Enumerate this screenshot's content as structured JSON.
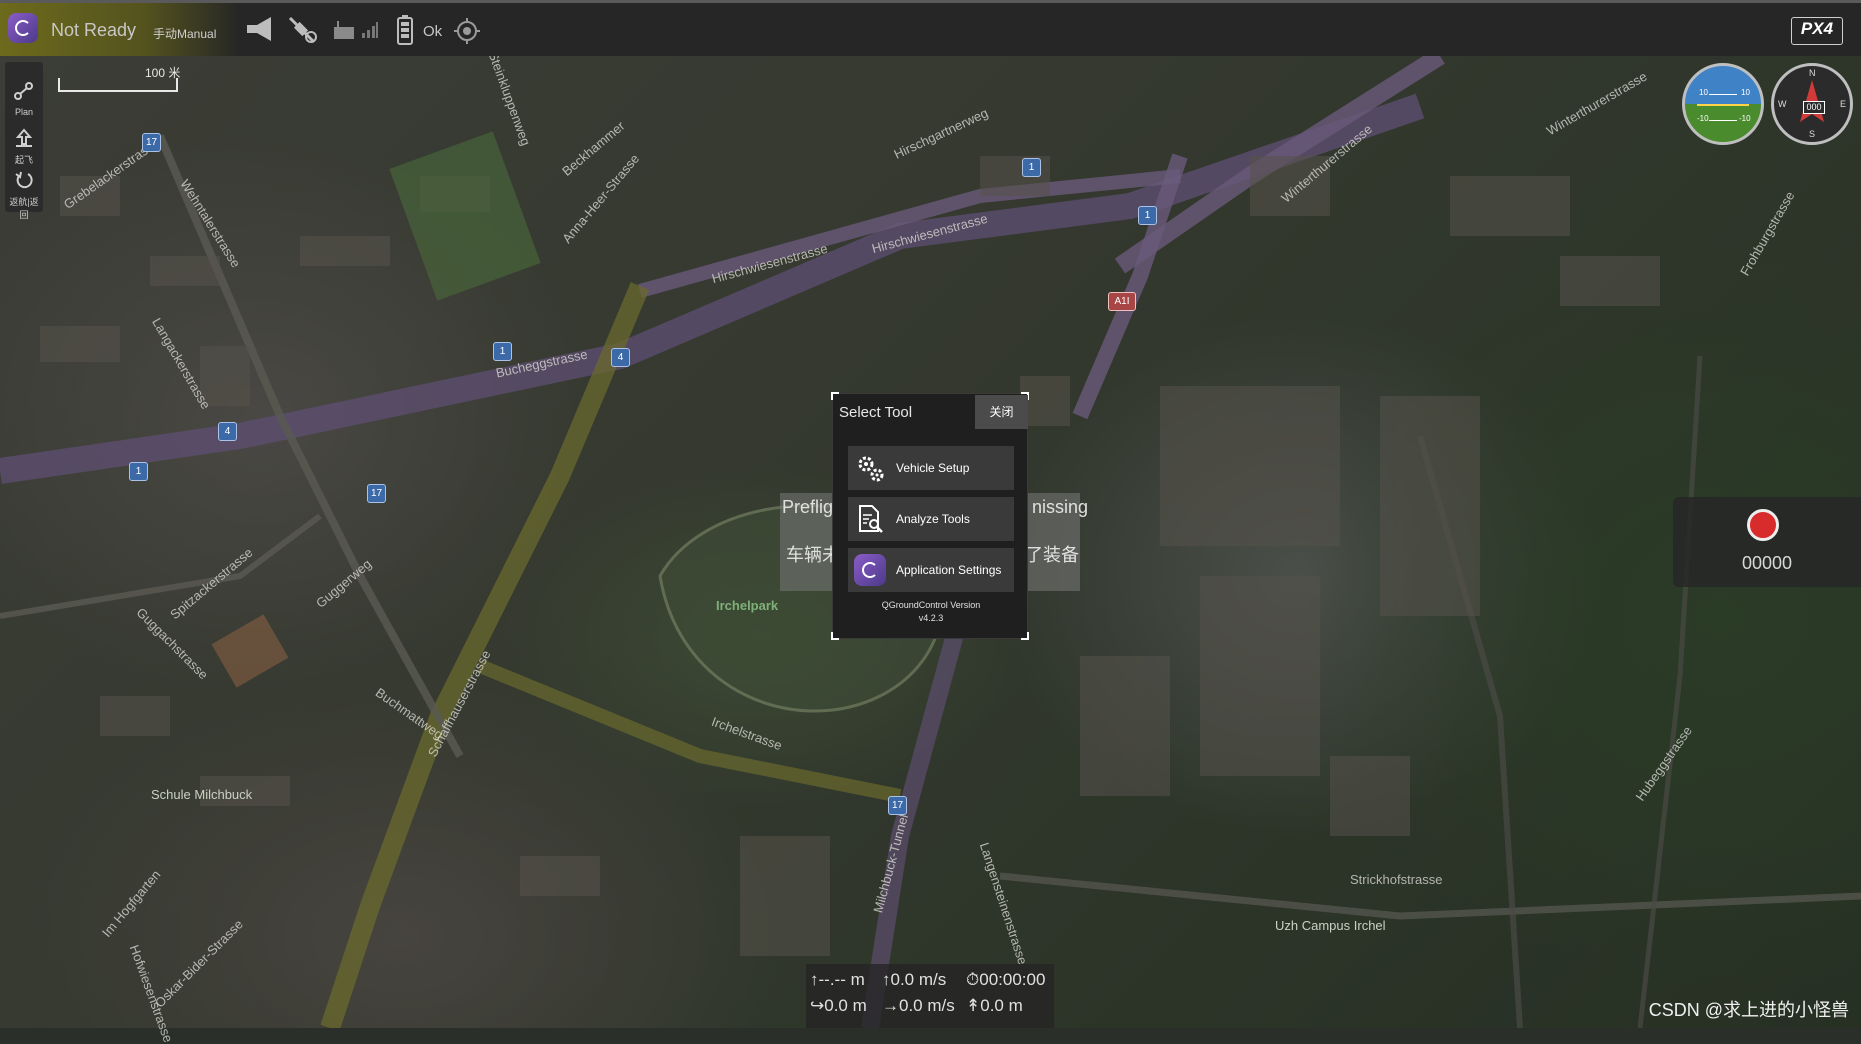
{
  "toolbar": {
    "readiness": "Not Ready",
    "flight_mode": "手动Manual",
    "battery_status": "Ok",
    "icons": [
      "qgc-app-icon",
      "megaphone-icon",
      "gps-off-icon",
      "rc-icon",
      "signal-icon",
      "battery-icon",
      "gimbal-icon"
    ],
    "logo": "PX4"
  },
  "left_strip": {
    "items": [
      {
        "icon": "plan-icon",
        "label": "Plan"
      },
      {
        "icon": "takeoff-icon",
        "label": "起飞"
      },
      {
        "icon": "return-icon",
        "label": "返航|返回"
      }
    ]
  },
  "map": {
    "scale_label": "100 米",
    "street_labels": [
      "Wehntalerstrasse",
      "Hirschwiesenstrasse",
      "Hirschwiesenstrasse",
      "Winterthurerstrasse",
      "Bucheggstrasse",
      "Schaffhauserstrasse",
      "Irchelstrasse",
      "Milchbuck-Tunnel",
      "Langensteinenstrasse",
      "Strickhofstrasse",
      "Winterthurerstrasse",
      "Frohburgstrasse",
      "Hubeggstrasse",
      "Hirschgartnerweg",
      "Langackerstrasse",
      "Spitzackerstrasse",
      "Buchmattweg",
      "Guggachstrasse",
      "Oskar-Bider-Strasse",
      "Im Hogfgarten",
      "Grebelackerstrasse",
      "Beckhammer",
      "Anna-Heer-Strasse",
      "Steinkluppenweg",
      "Hofwiesenstrasse",
      "Guggerweg"
    ],
    "route_shields": [
      "17",
      "1",
      "1",
      "4",
      "4",
      "1",
      "17",
      "1",
      "17",
      "A1I"
    ],
    "poi_labels": {
      "park": "Irchelpark",
      "school": "Schule Milchbuck",
      "campus": "Uzh Campus Irchel"
    }
  },
  "instruments": {
    "attitude_ticks": [
      "10",
      "10",
      "-10",
      "-10"
    ],
    "compass_letters": [
      "N",
      "E",
      "S",
      "W"
    ],
    "heading": "000"
  },
  "record_panel": {
    "count": "00000"
  },
  "preflight_message": {
    "line1_left": "Prefligh",
    "line1_right": "nissing",
    "line2_left": "车辆未",
    "line2_right": "了装备"
  },
  "select_tool": {
    "title": "Select Tool",
    "close_label": "关闭",
    "buttons": [
      {
        "label": "Vehicle Setup",
        "icon": "gear-icon"
      },
      {
        "label": "Analyze Tools",
        "icon": "analyze-icon"
      },
      {
        "label": "Application Settings",
        "icon": "qgc-app-icon"
      }
    ],
    "version_label": "QGroundControl Version",
    "version": "v4.2.3"
  },
  "telemetry": {
    "altitude": "↑--.-- m",
    "vertical_speed": "↑0.0 m/s",
    "flight_time": "⏱00:00:00",
    "distance": "↪0.0 m",
    "horizontal_speed": "→0.0 m/s",
    "home_distance": "↟0.0 m"
  },
  "watermark": "CSDN @求上进的小怪兽"
}
